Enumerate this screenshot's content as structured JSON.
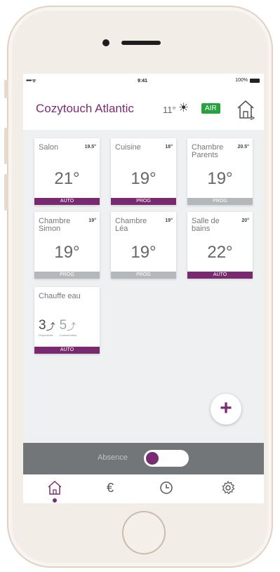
{
  "status_bar": {
    "signal": "••••• ᯤ",
    "time": "9:41",
    "battery": "100%"
  },
  "header": {
    "title": "Cozytouch Atlantic",
    "outdoor_temp": "11°",
    "weather_icon": "sun-icon",
    "air_badge": "AIR",
    "home_icon": "house-icon"
  },
  "colors": {
    "brand": "#7a2c73",
    "air_green": "#27a23f",
    "mode_grey": "#b5b8ba"
  },
  "rooms": [
    {
      "name": "Salon",
      "measured": "19.5°",
      "target": "21°",
      "mode": "AUTO"
    },
    {
      "name": "Cuisine",
      "measured": "18°",
      "target": "19°",
      "mode": "PROG"
    },
    {
      "name": "Chambre Parents",
      "measured": "20.5°",
      "target": "19°",
      "mode": "PROG"
    },
    {
      "name": "Chambre Simon",
      "measured": "19°",
      "target": "19°",
      "mode": "PROG"
    },
    {
      "name": "Chambre Léa",
      "measured": "19°",
      "target": "19°",
      "mode": "PROG"
    },
    {
      "name": "Salle de bains",
      "measured": "20°",
      "target": "22°",
      "mode": "AUTO"
    }
  ],
  "water_heater": {
    "name": "Chauffe eau",
    "available": "3",
    "available_label": "Disponibles",
    "consumed": "5",
    "consumed_label": "Consommées",
    "mode": "AUTO"
  },
  "fab_label": "+",
  "absence": {
    "label": "Absence",
    "enabled": true
  },
  "tabs": [
    {
      "icon": "home-icon",
      "active": true
    },
    {
      "icon": "euro-icon",
      "glyph": "€"
    },
    {
      "icon": "clock-icon"
    },
    {
      "icon": "gear-icon"
    }
  ]
}
